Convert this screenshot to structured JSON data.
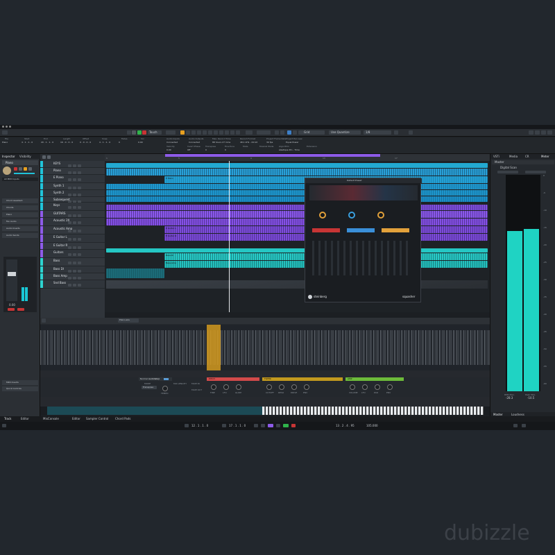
{
  "watermark": "dubizzle",
  "toolbar": {
    "automation_mode": "Touch",
    "snap_type": "Grid",
    "quantize_type": "Use Quantize",
    "quantize_value": "1/8"
  },
  "info_line": {
    "fields": [
      {
        "label": "File",
        "value": "Piano"
      },
      {
        "label": "Start",
        "value": "4 . 1 . 1 . 0"
      },
      {
        "label": "End",
        "value": "20 . 1 . 1 . 0"
      },
      {
        "label": "Length",
        "value": "16 . 0 . 0 . 0"
      },
      {
        "label": "Offset",
        "value": "0 . 0 . 0 . 0"
      },
      {
        "label": "Snap",
        "value": "4 . 1 . 1 . 0"
      },
      {
        "label": "Fades",
        "value": "0"
      },
      {
        "label": "Vol",
        "value": "0.00"
      }
    ],
    "status": [
      {
        "label": "Audio Inputs",
        "value": "Connected"
      },
      {
        "label": "Audio Outputs",
        "value": "Connected"
      },
      {
        "label": "Max. Record Time",
        "value": "88 hours 27 mins"
      },
      {
        "label": "Record Format",
        "value": "48.1 kHz - 24 bit"
      },
      {
        "label": "Project Frame Rate",
        "value": "30 fps"
      },
      {
        "label": "Project Pan Law",
        "value": "Equal Power"
      }
    ],
    "second_row": [
      {
        "label": "Velocity",
        "value": "0.00"
      },
      {
        "label": "Invert Phase",
        "value": "Off"
      },
      {
        "label": "Transpose",
        "value": "0"
      },
      {
        "label": "Fine-Tune",
        "value": "0"
      },
      {
        "label": "Mute",
        "value": ""
      },
      {
        "label": "Musical Mode",
        "value": ""
      },
      {
        "label": "Algorithm",
        "value": "élastique Pro - Time"
      },
      {
        "label": "Extension",
        "value": ""
      }
    ]
  },
  "inspector": {
    "tabs": [
      "Inspector",
      "Visibility"
    ],
    "track_name": "Piano",
    "input": "All MIDI Inputs",
    "sections": [
      "Chord Assistant",
      "Chords",
      "Piano",
      "Fav Audio",
      "Audio Inserts",
      "Audio Sends"
    ],
    "fader_value": "0.00",
    "sections_bottom": [
      "MIDI Inserts",
      "Quick Controls"
    ]
  },
  "tracks": [
    {
      "name": "KEYS",
      "color": "#21c3d9"
    },
    {
      "name": "Piano",
      "color": "#21c3d9"
    },
    {
      "name": "E Piano",
      "color": "#21c3d9"
    },
    {
      "name": "Synth 1",
      "color": "#21c3d9"
    },
    {
      "name": "Synth 2",
      "color": "#21c3d9"
    },
    {
      "name": "Subsequent",
      "color": "#21c3d9"
    },
    {
      "name": "Keys",
      "color": "#21c3d9"
    },
    {
      "name": "GUITARS",
      "color": "#8d5be8"
    },
    {
      "name": "Acoustic 2X",
      "color": "#8d5be8"
    },
    {
      "name": "Acoustic Amp",
      "color": "#8d5be8"
    },
    {
      "name": "E Guitar L",
      "color": "#8d5be8"
    },
    {
      "name": "E Guitar R",
      "color": "#8d5be8"
    },
    {
      "name": "Guitars",
      "color": "#8d5be8"
    },
    {
      "name": "Bass",
      "color": "#2ed3d0"
    },
    {
      "name": "Bass DI",
      "color": "#2ed3d0"
    },
    {
      "name": "Bass Amp",
      "color": "#2ed3d0"
    },
    {
      "name": "Snd Bass",
      "color": "#2ed3d0"
    }
  ],
  "ruler": {
    "marks": [
      "1",
      "5",
      "9",
      "13",
      "17"
    ]
  },
  "event_labels": [
    "E Piano",
    "E Guitar L",
    "E Guitar R",
    "Bass DI",
    "Bass Amp"
  ],
  "plugin": {
    "brand": "steinberg",
    "name": "squasher",
    "preset": "Default Preset"
  },
  "sampler": {
    "header": "Piano.wav",
    "tabs": [
      "Normal",
      "AudioWarp",
      "Slice"
    ],
    "sections": [
      {
        "name": "PITCH",
        "color": "#d24a4a",
        "knobs": [
          "FINE",
          "LFO",
          "GLIDE"
        ]
      },
      {
        "name": "FILTER",
        "color": "#c39a1e",
        "knobs": [
          "CUTOFF",
          "RESO",
          "DRIVE",
          "ENV"
        ]
      },
      {
        "name": "AMP",
        "color": "#6dbb3a",
        "knobs": [
          "VOLUME",
          "LFO",
          "PAN",
          "ENV"
        ]
      }
    ],
    "mode_label": "MODE",
    "mode_value": "Transpose",
    "tempo_label": "TEMPO",
    "knob_labels": [
      "TEMPO",
      "MIX LENGTH",
      "FADE IN",
      "FADE OUT"
    ]
  },
  "meter": {
    "tabs": [
      "VSTi",
      "Media",
      "CR",
      "Meter"
    ],
    "section": "Master",
    "device": "Digital Scan",
    "scale": [
      "0",
      "-5",
      "-10",
      "-15",
      "-20",
      "-25",
      "-30",
      "-35",
      "-40",
      "-45",
      "-50",
      "-55",
      "-60"
    ],
    "left_level": 0.74,
    "right_level": 0.75,
    "rms_label": "RMS Max.",
    "rms_value": "-28.3",
    "peak_label": "Peak Max.",
    "peak_value": "-10.5",
    "bottom_tabs": [
      "Master",
      "Loudness"
    ]
  },
  "bottom_tabs": [
    "Track",
    "Editor",
    "MixConsole",
    "Editor",
    "Sampler Control",
    "Chord Pads"
  ],
  "transport": {
    "left_locator": "12 . 1 . 1 . 0",
    "right_locator": "17 . 1 . 1 . 0",
    "position": "13 . 2 . 4 . 95",
    "tempo": "105.000"
  },
  "colors": {
    "keys": "#21c3d9",
    "guitars": "#8d5be8",
    "bass": "#2ed3d0",
    "selection": "#e8a020"
  }
}
